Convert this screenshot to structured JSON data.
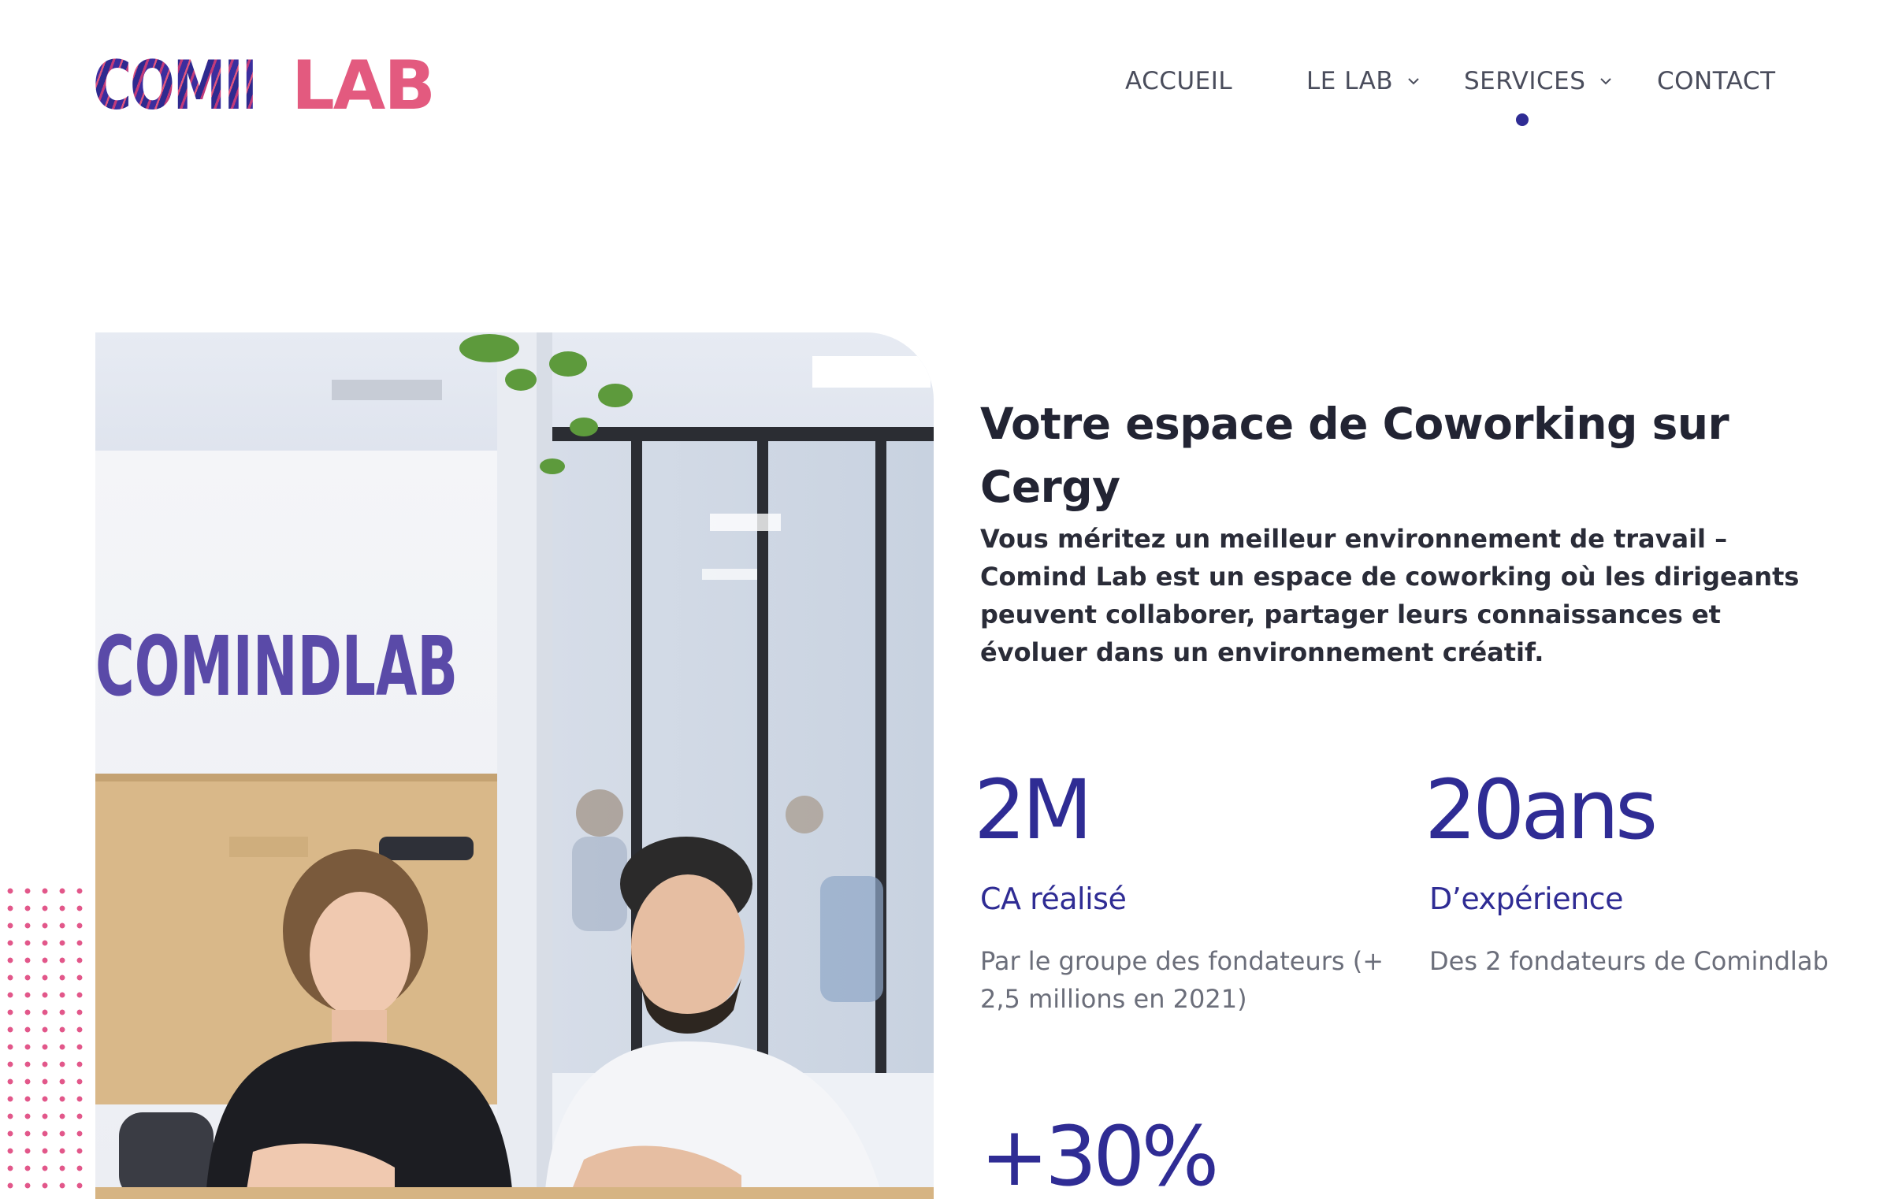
{
  "header": {
    "logo": {
      "part_a": "COMIND",
      "part_b": "LAB",
      "alt": "COMINDLAB"
    },
    "nav": [
      {
        "label": "ACCUEIL",
        "has_dropdown": false,
        "active": false
      },
      {
        "label": "LE LAB",
        "has_dropdown": true,
        "active": false
      },
      {
        "label": "SERVICES",
        "has_dropdown": true,
        "active": true
      },
      {
        "label": "CONTACT",
        "has_dropdown": false,
        "active": false
      }
    ]
  },
  "hero": {
    "photo_wall_sign": "COMINDLAB",
    "headline": "Votre espace de Coworking sur Cergy",
    "intro": "Vous méritez un meilleur environnement de travail – Comind Lab est un espace de coworking où les dirigeants peuvent collaborer, partager leurs connaissances et évoluer dans un environnement créatif."
  },
  "stats": [
    {
      "value": "2M",
      "label": "CA réalisé",
      "desc": "Par le groupe des fondateurs (+ 2,5 millions en 2021)"
    },
    {
      "value": "20ans",
      "label": "D’expérience",
      "desc": "Des 2 fondateurs de Comindlab"
    },
    {
      "value": "+30%"
    }
  ],
  "colors": {
    "brand_indigo": "#2f2c94",
    "brand_pink": "#e35a7f",
    "nav_text": "#4a4d5c",
    "body_text": "#2a2c38",
    "muted_text": "#6b6e7a"
  }
}
